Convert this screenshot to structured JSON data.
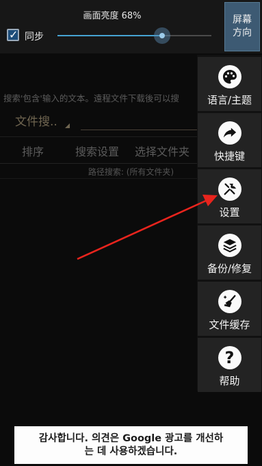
{
  "brightness": {
    "title": "画面亮度 68%",
    "percent": 68,
    "sync_label": "同步",
    "sync_checked": true,
    "rotate_label_line1": "屏幕",
    "rotate_label_line2": "方向"
  },
  "background": {
    "search_hint": "搜索'包含'输入的文本。遠程文件下载後可以搜",
    "file_search_label": "文件搜..",
    "toolbar": {
      "sort": "排序",
      "search_settings": "搜索设置",
      "select_folder": "选择文件夹"
    },
    "path_search": "路径搜索: (所有文件夹)"
  },
  "menu": {
    "items": [
      {
        "label": "语言/主题",
        "icon": "palette-icon"
      },
      {
        "label": "快捷键",
        "icon": "share-arrow-icon"
      },
      {
        "label": "设置",
        "icon": "wrench-screwdriver-icon"
      },
      {
        "label": "备份/修复",
        "icon": "layers-icon"
      },
      {
        "label": "文件缓存",
        "icon": "broom-icon"
      },
      {
        "label": "帮助",
        "icon": "question-icon"
      }
    ]
  },
  "ad": {
    "line1": "감사합니다. 의견은 Google 광고를 개선하",
    "line2": "는 데 사용하겠습니다."
  },
  "colors": {
    "accent": "#46a3d2",
    "rotate_button": "#3d5a73",
    "menu_bg": "#232323",
    "arrow": "#e8241d"
  }
}
